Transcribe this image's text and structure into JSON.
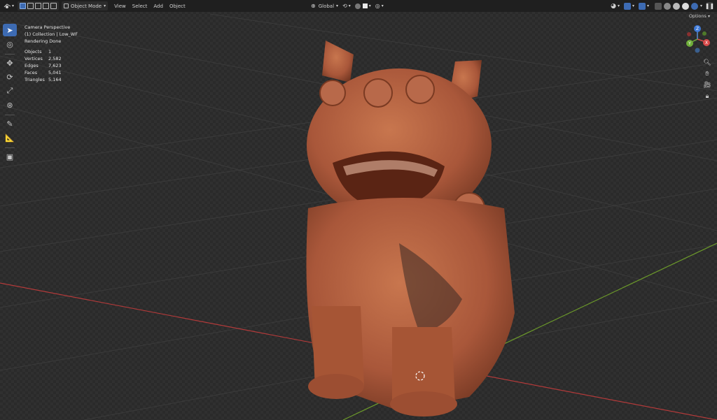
{
  "header": {
    "mode_label": "Object Mode",
    "menus": [
      "View",
      "Select",
      "Add",
      "Object"
    ],
    "transform_orientation": "Global"
  },
  "overlay": {
    "view_name": "Camera Perspective",
    "collection_line": "(1) Collection | Low_WF",
    "status": "Rendering Done",
    "stats": [
      {
        "label": "Objects",
        "value": "1"
      },
      {
        "label": "Vertices",
        "value": "2,582"
      },
      {
        "label": "Edges",
        "value": "7,623"
      },
      {
        "label": "Faces",
        "value": "5,041"
      },
      {
        "label": "Triangles",
        "value": "5,164"
      }
    ]
  },
  "options_label": "Options",
  "tools": [
    "select-box",
    "cursor",
    "move",
    "rotate",
    "scale",
    "transform",
    "annotate",
    "measure",
    "add-cube"
  ],
  "colors": {
    "header_bg": "#1f1f1f",
    "active_tool": "#3d6bb3",
    "x_axis": "#c03a3a",
    "y_axis": "#6c9a2a",
    "statue": "#b5603d"
  },
  "gizmo": {
    "x": "X",
    "y": "Y",
    "z": "Z"
  }
}
